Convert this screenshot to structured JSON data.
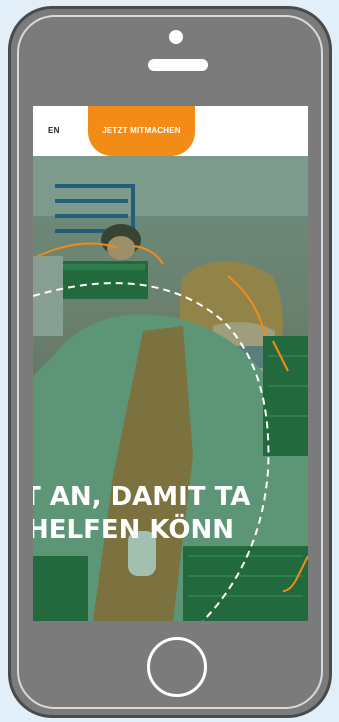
{
  "device": {
    "type": "smartphone",
    "frame_color": "#7b7b7b"
  },
  "page": {
    "nav": {
      "fragment_label": "EN"
    },
    "cta": {
      "label": "JETZT MITMACHEN",
      "color": "#f28c16"
    },
    "hero": {
      "headline_lines": [
        "T AN, DAMIT TA",
        "HELFEN KÖNN"
      ],
      "overlay_color": "#4a9a68"
    }
  }
}
